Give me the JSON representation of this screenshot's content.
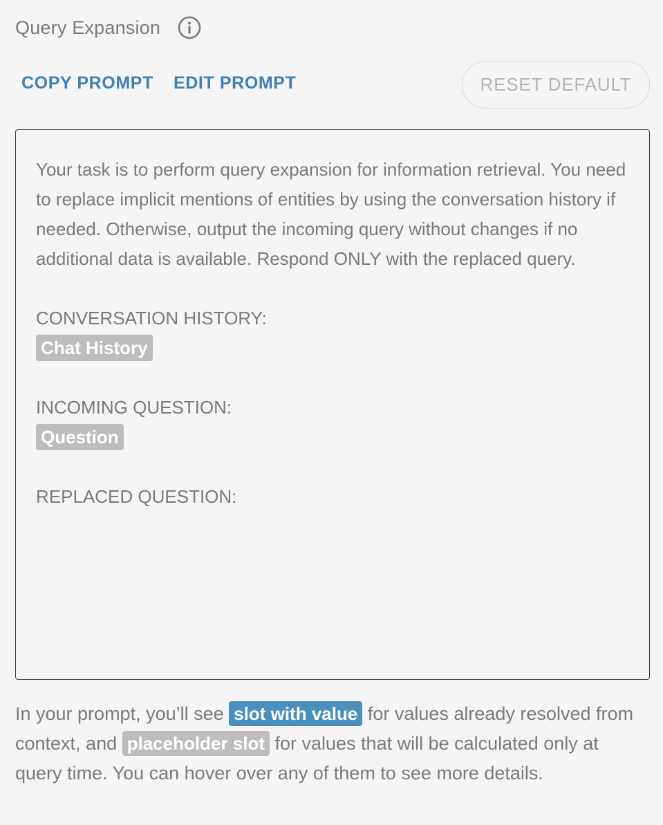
{
  "header": {
    "title": "Query Expansion",
    "info_icon": "info-icon"
  },
  "actions": {
    "copy_label": "COPY PROMPT",
    "edit_label": "EDIT PROMPT",
    "reset_label": "RESET DEFAULT"
  },
  "prompt": {
    "intro": "Your task is to perform query expansion for information retrieval. You need to replace implicit mentions of entities by using the conversation history if needed. Otherwise, output the incoming query without changes if no additional data is available. Respond ONLY with the replaced query.",
    "history_label": "CONVERSATION HISTORY:",
    "history_slot": "Chat History",
    "question_label": "INCOMING QUESTION:",
    "question_slot": "Question",
    "replaced_label": "REPLACED QUESTION:"
  },
  "footer": {
    "part1": "In your prompt, you’ll see ",
    "value_slot": "slot with value",
    "part2": " for values already resolved from context, and ",
    "placeholder_slot": "placeholder slot",
    "part3": " for values that will be calculated only at query time. You can hover over any of them to see more details."
  },
  "colors": {
    "accent": "#3f7fb3",
    "slot_value": "#4a90be",
    "slot_placeholder": "#bdbdbd",
    "text": "#7a7a7a",
    "background": "#f5f5f5"
  }
}
